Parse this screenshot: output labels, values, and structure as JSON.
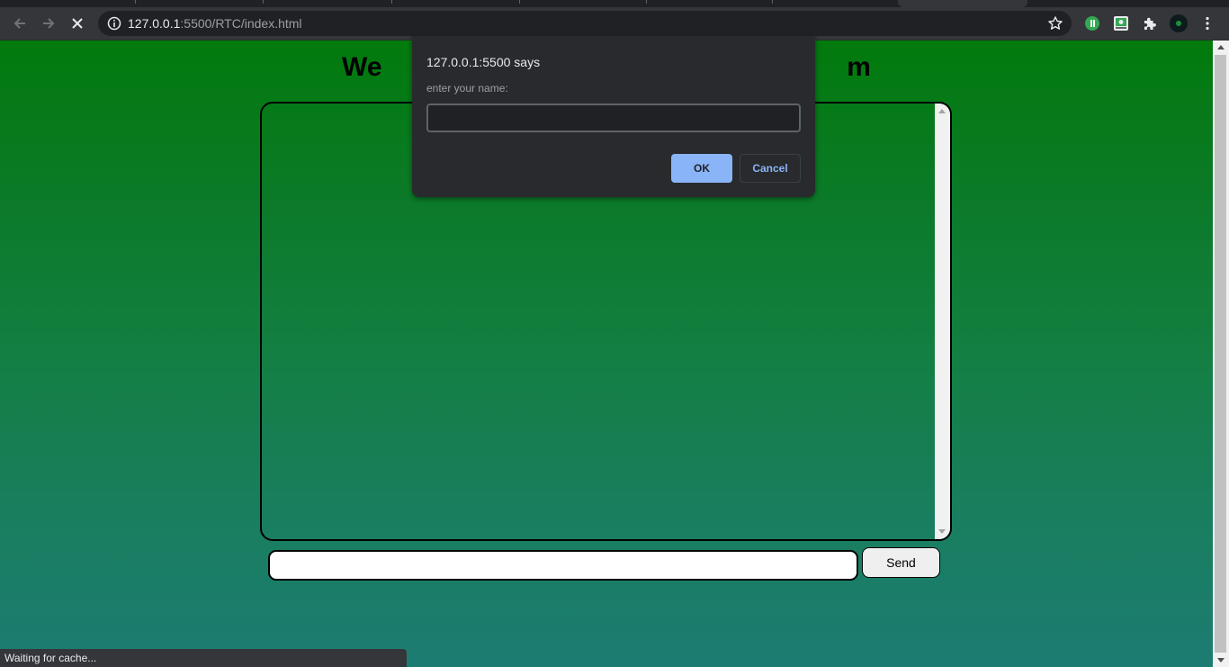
{
  "browser": {
    "url_host": "127.0.0.1",
    "url_rest": ":5500/RTC/index.html",
    "status_text": "Waiting for cache..."
  },
  "icons": {
    "back": "back-arrow-icon",
    "forward": "forward-arrow-icon",
    "stop": "stop-loading-icon",
    "info": "site-info-icon",
    "bookmark": "bookmark-star-icon",
    "extensions": "extensions-puzzle-icon",
    "menu": "kebab-menu-icon"
  },
  "page": {
    "title": "We                                                              m",
    "message_value": "",
    "send_label": "Send"
  },
  "dialog": {
    "origin": "127.0.0.1:5500 says",
    "message": "enter your name:",
    "input_value": "",
    "ok_label": "OK",
    "cancel_label": "Cancel"
  },
  "colors": {
    "gradient_top": "#027a0c",
    "gradient_bottom": "#1c7c72",
    "dialog_bg": "#292a2d",
    "accent": "#8ab4f8"
  }
}
